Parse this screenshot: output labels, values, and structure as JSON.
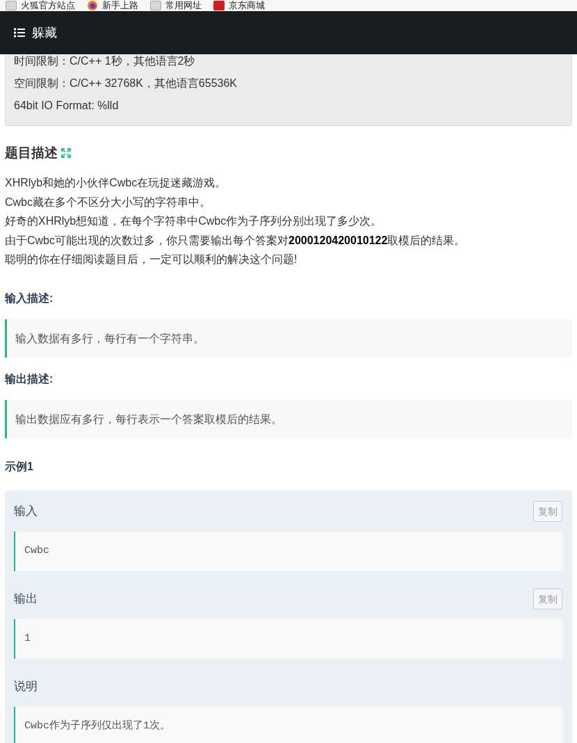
{
  "bookmarks": [
    {
      "label": "火狐官方站点",
      "kind": "page"
    },
    {
      "label": "新手上路",
      "kind": "browser"
    },
    {
      "label": "常用网址",
      "kind": "page"
    },
    {
      "label": "京东商城",
      "kind": "shop"
    }
  ],
  "navbar": {
    "title": "躲藏"
  },
  "limits": [
    "时间限制：C/C++ 1秒，其他语言2秒",
    "空间限制：C/C++ 32768K，其他语言65536K",
    "64bit IO Format: %lld"
  ],
  "description": {
    "title": "题目描述",
    "paragraphs": [
      "XHRlyb和她的小伙伴Cwbc在玩捉迷藏游戏。",
      "Cwbc藏在多个不区分大小写的字符串中。",
      "好奇的XHRlyb想知道，在每个字符串中Cwbc作为子序列分别出现了多少次。",
      "由于Cwbc可能出现的次数过多，你只需要输出每个答案对**2000120420010122**取模后的结果。",
      "聪明的你在仔细阅读题目后，一定可以顺利的解决这个问题!"
    ]
  },
  "input_description": {
    "title": "输入描述:",
    "text": "输入数据有多行，每行有一个字符串。"
  },
  "output_description": {
    "title": "输出描述:",
    "text": "输出数据应有多行，每行表示一个答案取模后的结果。"
  },
  "examples": [
    {
      "title": "示例1",
      "sections": [
        {
          "label": "输入",
          "content": "Cwbc",
          "copy_button": "复制"
        },
        {
          "label": "输出",
          "content": "1",
          "copy_button": "复制"
        },
        {
          "label": "说明",
          "content": "Cwbc作为子序列仅出现了1次。"
        }
      ]
    }
  ]
}
